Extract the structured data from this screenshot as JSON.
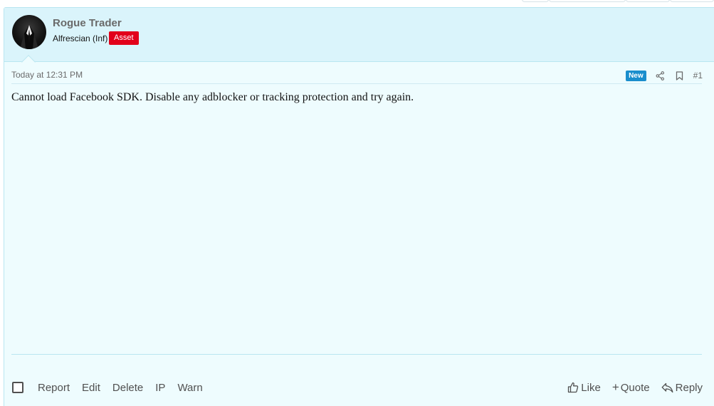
{
  "author": {
    "name": "Rogue Trader",
    "title": "Alfrescian (Inf)",
    "badge": "Asset",
    "badge_color": "#e2001a"
  },
  "post": {
    "time": "Today at 12:31 PM",
    "new_badge": "New",
    "number": "#1",
    "message": "Cannot load Facebook SDK. Disable any adblocker or tracking protection and try again."
  },
  "actions": {
    "left": [
      "Report",
      "Edit",
      "Delete",
      "IP",
      "Warn"
    ],
    "like": "Like",
    "quote": "Quote",
    "reply": "Reply"
  },
  "colors": {
    "header_bg": "#daf4fb",
    "post_bg": "#eefcfe",
    "border": "#b9e6f1",
    "new_badge": "#1a8ecd"
  },
  "icons": [
    "share-icon",
    "bookmark-icon",
    "thumbs-up-icon",
    "plus-icon",
    "reply-arrow-icon"
  ]
}
